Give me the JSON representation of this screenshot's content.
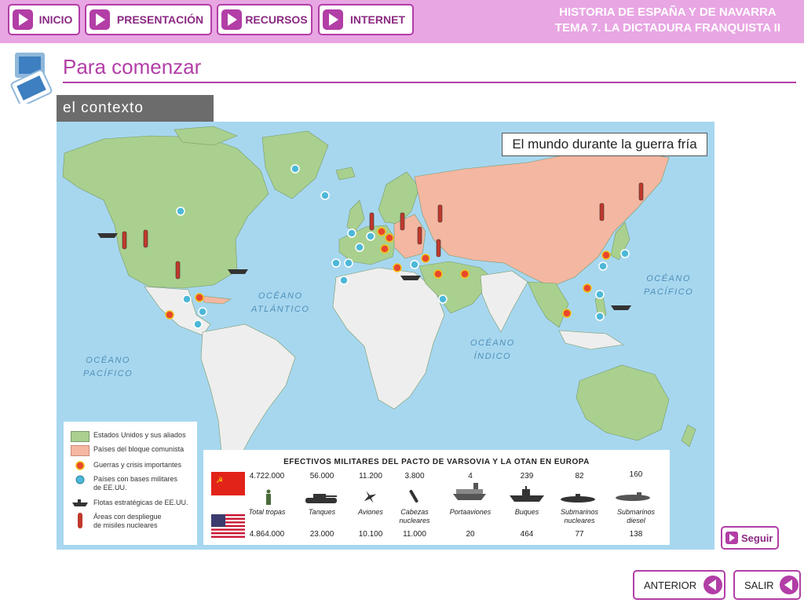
{
  "nav": {
    "inicio": "INICIO",
    "presentacion": "PRESENTACIÓN",
    "recursos": "RECURSOS",
    "internet": "INTERNET"
  },
  "course": {
    "line1": "HISTORIA DE ESPAÑA Y DE NAVARRA",
    "line2": "TEMA 7. LA DICTADURA FRANQUISTA II"
  },
  "page": {
    "title": "Para comenzar",
    "section": "el contexto"
  },
  "map": {
    "title": "El mundo durante la guerra fría",
    "oceans": [
      {
        "line1": "OCÉANO",
        "line2": "ATLÁNTICO"
      },
      {
        "line1": "OCÉANO",
        "line2": "PACÍFICO"
      },
      {
        "line1": "OCÉANO",
        "line2": "ÍNDICO"
      },
      {
        "line1": "OCÉANO",
        "line2": "PACÍFICO"
      }
    ],
    "legend": [
      {
        "label": "Estados Unidos y sus aliados"
      },
      {
        "label": "Países del bloque comunista"
      },
      {
        "label": "Guerras y crisis importantes"
      },
      {
        "label": "Países con bases militares",
        "label2": "de EE.UU."
      },
      {
        "label": "Flotas estratégicas de EE.UU."
      },
      {
        "label": "Áreas con despliegue",
        "label2": "de misiles nucleares"
      }
    ],
    "colors": {
      "ocean": "#a7d7ef",
      "usa_allies": "#a9d08e",
      "communist": "#f4b7a1",
      "neutral": "#eeeeee"
    }
  },
  "stats": {
    "title": "EFECTIVOS MILITARES DEL PACTO DE VARSOVIA Y LA OTAN EN EUROPA",
    "categories": [
      "Total tropas",
      "Tanques",
      "Aviones",
      "Cabezas nucleares",
      "Portaaviones",
      "Buques",
      "Submarinos nucleares",
      "Submarinos diesel"
    ],
    "warsaw": [
      "4.722.000",
      "56.000",
      "11.200",
      "3.800",
      "4",
      "239",
      "82",
      "160"
    ],
    "nato": [
      "4.864.000",
      "23.000",
      "10.100",
      "11.000",
      "20",
      "464",
      "77",
      "138"
    ]
  },
  "buttons": {
    "seguir": "Seguir",
    "anterior": "ANTERIOR",
    "salir": "SALIR"
  }
}
